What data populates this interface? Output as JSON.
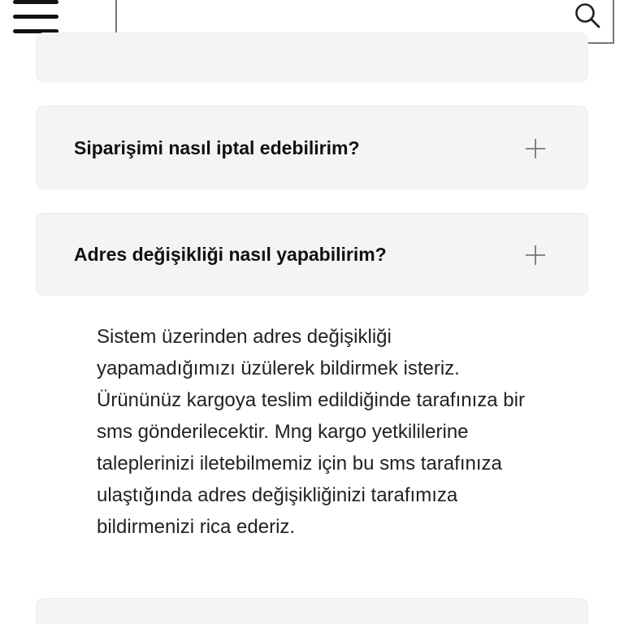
{
  "header": {
    "menu_icon": "hamburger-menu-icon",
    "search": {
      "value": "",
      "placeholder": "",
      "icon": "search-icon"
    }
  },
  "faq": {
    "items": [
      {
        "question": "",
        "expanded": false
      },
      {
        "question": "Siparişimi nasıl iptal edebilirim?",
        "expanded": false,
        "icon": "plus-icon"
      },
      {
        "question": "Adres değişikliği nasıl yapabilirim?",
        "expanded": true,
        "icon": "plus-icon",
        "answer": "Sistem üzerinden adres değişikliği yapamadığımızı üzülerek bildirmek isteriz. Ürününüz kargoya teslim edildiğinde tarafınıza bir sms gönderilecektir. Mng kargo yetkililerine taleplerinizi iletebilmemiz için bu sms tarafınıza ulaştığında adres değişikliğinizi tarafımıza bildirmenizi rica ederiz."
      },
      {
        "question": "",
        "expanded": false
      }
    ]
  },
  "colors": {
    "card_background": "#f4f4f4",
    "text": "#111111",
    "icon_gray": "#777777"
  }
}
